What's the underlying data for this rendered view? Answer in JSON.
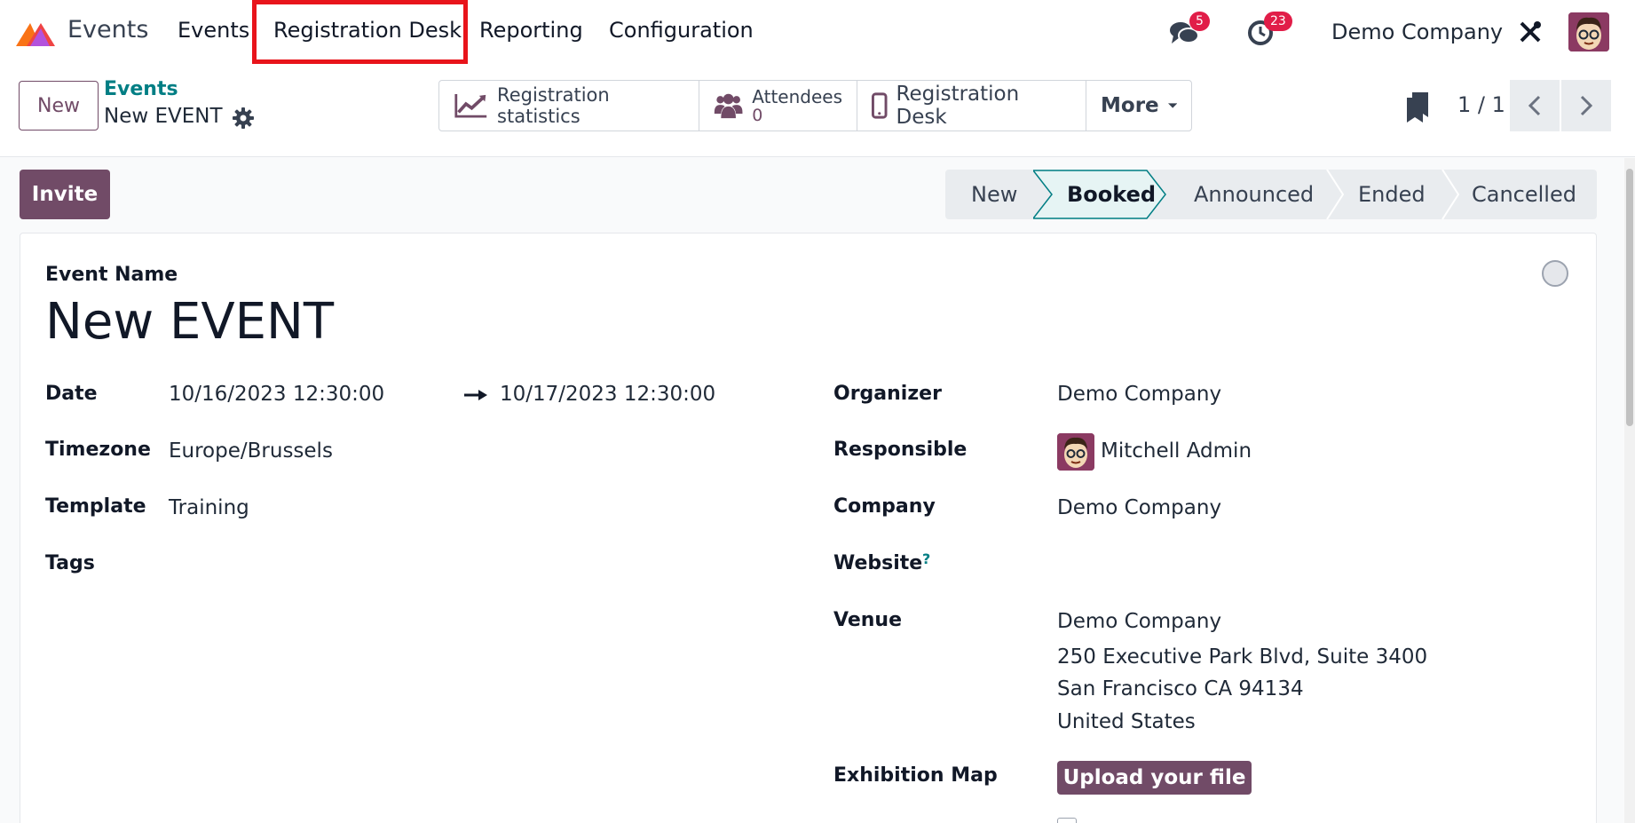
{
  "navbar": {
    "app_name": "Events",
    "menu": [
      "Events",
      "Registration Desk",
      "Reporting",
      "Configuration"
    ],
    "messages_badge": "5",
    "activities_badge": "23",
    "company": "Demo Company"
  },
  "control_panel": {
    "new_label": "New",
    "breadcrumb": "Events",
    "record_name": "New EVENT",
    "smart_buttons": {
      "stats": "Registration statistics",
      "attendees_label": "Attendees",
      "attendees_count": "0",
      "desk": "Registration Desk",
      "more": "More"
    },
    "pager": "1 / 1"
  },
  "actions": {
    "invite": "Invite"
  },
  "statusbar": {
    "stages": [
      "New",
      "Booked",
      "Announced",
      "Ended",
      "Cancelled"
    ],
    "current": "Booked"
  },
  "form": {
    "event_name_label": "Event Name",
    "event_name": "New EVENT",
    "date_label": "Date",
    "date_start": "10/16/2023 12:30:00",
    "date_end": "10/17/2023 12:30:00",
    "timezone_label": "Timezone",
    "timezone": "Europe/Brussels",
    "template_label": "Template",
    "template": "Training",
    "tags_label": "Tags",
    "organizer_label": "Organizer",
    "organizer": "Demo Company",
    "responsible_label": "Responsible",
    "responsible": "Mitchell Admin",
    "company_label": "Company",
    "company": "Demo Company",
    "website_label": "Website",
    "website_help": "?",
    "venue_label": "Venue",
    "venue_lines": [
      "Demo Company",
      "250 Executive Park Blvd, Suite 3400",
      "San Francisco CA 94134",
      "United States"
    ],
    "exhibition_map_label": "Exhibition Map",
    "upload_label": "Upload your file"
  },
  "colors": {
    "brand": "#714b67",
    "link": "#017e84",
    "highlight": "#e8141b",
    "badge": "#e11d48"
  }
}
